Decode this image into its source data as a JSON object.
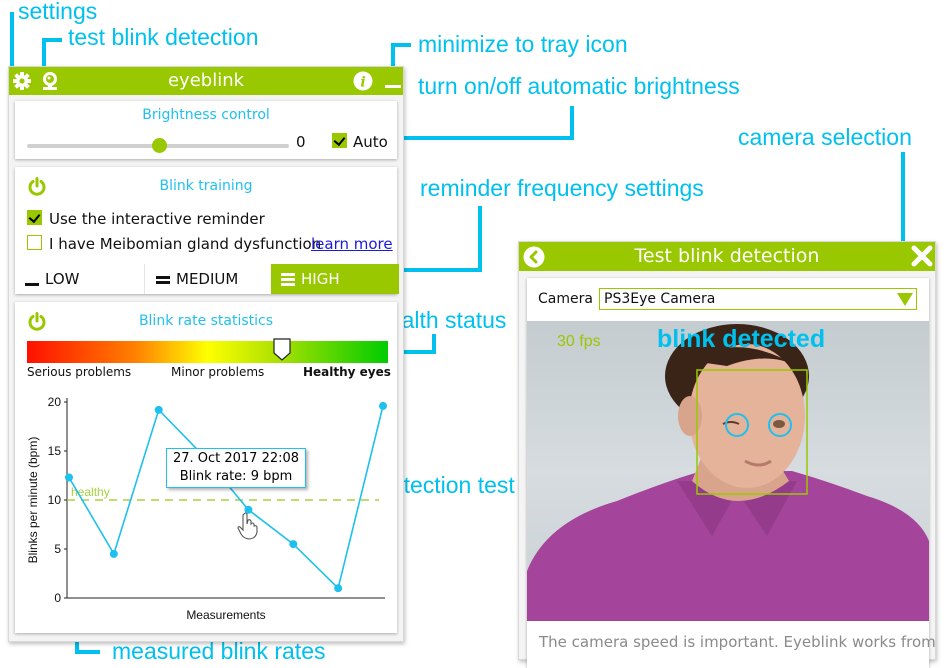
{
  "annotations": {
    "settings": "settings",
    "test_blink": "test blink detection",
    "minimize": "minimize to tray icon",
    "auto_brightness": "turn on/off automatic brightness",
    "camera_selection": "camera selection",
    "reminder_frequency": "reminder frequency settings",
    "health_status": "health status",
    "detection_test": "detection test",
    "measured_rates": "measured blink rates"
  },
  "main_window": {
    "title": "eyeblink",
    "icons": [
      "gear-icon",
      "webcam-icon",
      "info-icon",
      "minimize-icon"
    ],
    "brightness": {
      "title": "Brightness control",
      "value": "0",
      "slider_fraction": 0.5,
      "auto_label": "Auto",
      "auto_checked": true
    },
    "training": {
      "title": "Blink training",
      "reminder_label": "Use the interactive reminder",
      "reminder_checked": true,
      "meibomian_label": "I have Meibomian gland dysfunction",
      "meibomian_checked": false,
      "learn_more": "learn more",
      "frequency": [
        {
          "label": "LOW",
          "active": false
        },
        {
          "label": "MEDIUM",
          "active": false
        },
        {
          "label": "HIGH",
          "active": true
        }
      ]
    },
    "statistics": {
      "title": "Blink rate statistics",
      "health_labels": [
        "Serious problems",
        "Minor problems",
        "Healthy eyes"
      ],
      "health_position_fraction": 0.72,
      "tooltip_date": "27. Oct 2017 22:08",
      "tooltip_rate": "Blink rate: 9 bpm"
    }
  },
  "chart_data": {
    "type": "line",
    "title": "",
    "xlabel": "Measurements",
    "ylabel": "Blinks per minute (bpm)",
    "ylim": [
      0,
      20
    ],
    "yticks": [
      0,
      5,
      10,
      15,
      20
    ],
    "x": [
      0,
      1,
      2,
      3,
      4,
      5,
      6,
      7,
      8
    ],
    "values": [
      12.3,
      4.5,
      19.2,
      14.5,
      9,
      5.5,
      1,
      19.6
    ],
    "reference_line": {
      "value": 10,
      "label": "healthy",
      "color": "#a8d040"
    },
    "series_color": "#1ec0ee",
    "grid": false
  },
  "test_window": {
    "title": "Test blink detection",
    "camera_label": "Camera",
    "camera_value": "PS3Eye Camera",
    "fps": "30 fps",
    "status": "blink detected",
    "caption": "The camera speed is important. Eyeblink works from"
  },
  "colors": {
    "accent": "#99c800",
    "annotation": "#00c0ee"
  }
}
